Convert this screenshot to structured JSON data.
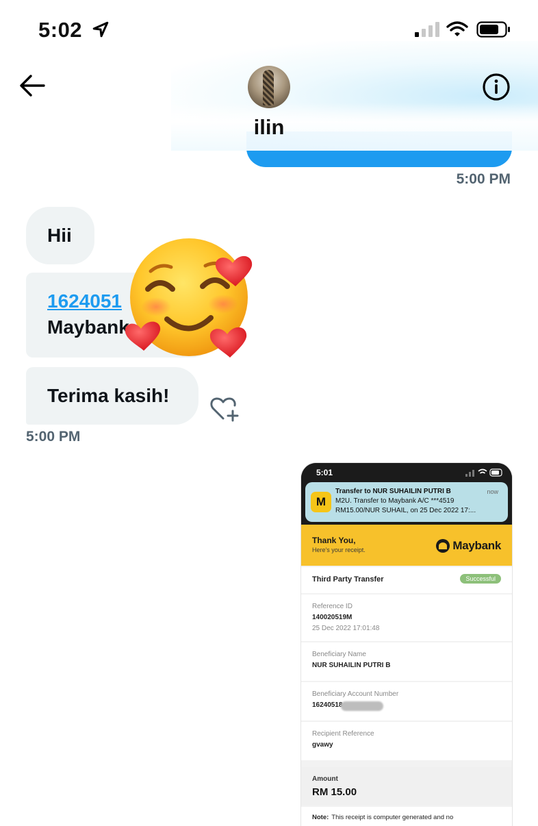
{
  "status_bar": {
    "time": "5:02"
  },
  "header": {
    "contact_name": "ilin"
  },
  "messages": {
    "sent_time": "5:00 PM",
    "received": [
      {
        "text": "Hii"
      },
      {
        "link_text": "1624051",
        "text": "Maybank"
      },
      {
        "text": "Terima kasih!"
      }
    ],
    "received_time": "5:00 PM"
  },
  "receipt_image": {
    "status_time": "5:01",
    "notification": {
      "icon_letter": "M",
      "title": "Transfer to NUR SUHAILIN PUTRI B",
      "time": "now",
      "line1": "M2U. Transfer to Maybank A/C ***4519",
      "line2": "RM15.00/NUR SUHAIL, on 25 Dec 2022 17:..."
    },
    "thanks": "Thank You,",
    "thanks_sub": "Here's your receipt.",
    "bank_logo": "Maybank",
    "transfer_type": "Third Party Transfer",
    "status_badge": "Successful",
    "reference_label": "Reference ID",
    "reference_id": "140020519M",
    "reference_date": "25 Dec 2022 17:01:48",
    "beneficiary_label": "Beneficiary Name",
    "beneficiary_name": "NUR SUHAILIN PUTRI B",
    "account_label": "Beneficiary Account Number",
    "account_number": "16240518",
    "recipient_ref_label": "Recipient Reference",
    "recipient_ref": "gvawy",
    "amount_label": "Amount",
    "amount": "RM 15.00",
    "note_label": "Note:",
    "note_text": "This receipt is computer generated and no"
  },
  "colors": {
    "accent": "#1d9bf0",
    "bubble_bg": "#eff3f4",
    "time_text": "#536471",
    "maybank_yellow": "#f7c12b",
    "success_badge": "#8dc07a"
  },
  "icons": {
    "back": "arrow-left-icon",
    "info": "info-circle-icon",
    "location": "location-arrow-icon",
    "react": "heart-plus-icon",
    "emoji": "smiling-face-with-hearts-emoji"
  }
}
